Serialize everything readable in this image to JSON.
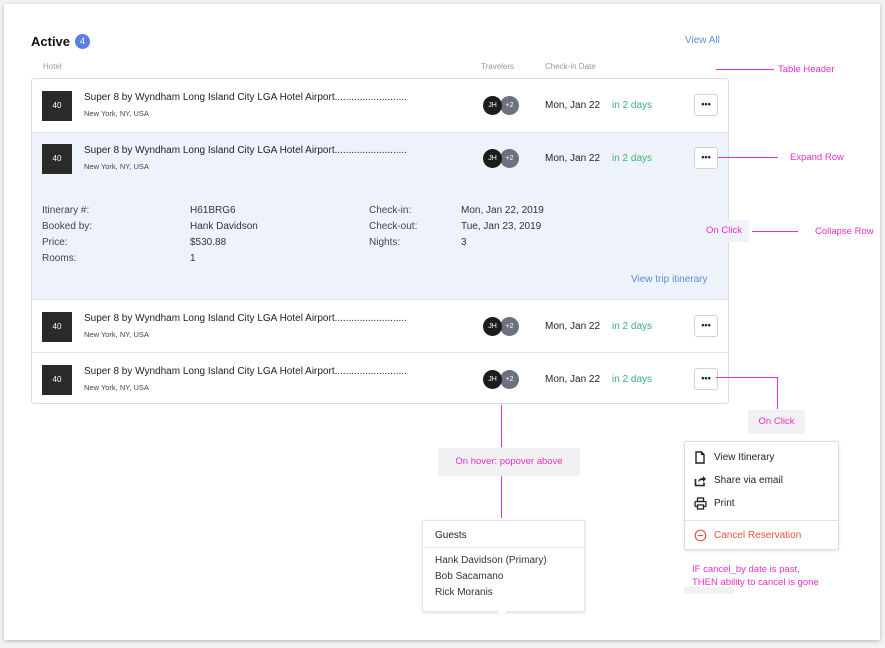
{
  "header": {
    "title": "Active",
    "count": "4",
    "view_all": "View All"
  },
  "columns": {
    "hotel": "Hotel",
    "travelers": "Travelers",
    "checkin": "Check-in Date"
  },
  "rows": [
    {
      "thumb": "40",
      "name": "Super 8 by Wyndham Long Island City LGA Hotel Airport..........................",
      "location": "New York, NY, USA",
      "avatar": "JH",
      "more": "+2",
      "date": "Mon, Jan 22",
      "relative": "in 2 days",
      "menu": "•••"
    },
    {
      "thumb": "40",
      "name": "Super 8 by Wyndham Long Island City LGA Hotel Airport..........................",
      "location": "New York, NY, USA",
      "avatar": "JH",
      "more": "+2",
      "date": "Mon, Jan 22",
      "relative": "in 2 days",
      "menu": "•••"
    },
    {
      "thumb": "40",
      "name": "Super 8 by Wyndham Long Island City LGA Hotel Airport..........................",
      "location": "New York, NY, USA",
      "avatar": "JH",
      "more": "+2",
      "date": "Mon, Jan 22",
      "relative": "in 2 days",
      "menu": "•••"
    },
    {
      "thumb": "40",
      "name": "Super 8 by Wyndham Long Island City LGA Hotel Airport..........................",
      "location": "New York, NY, USA",
      "avatar": "JH",
      "more": "+2",
      "date": "Mon, Jan 22",
      "relative": "in 2 days",
      "menu": "•••"
    }
  ],
  "detail": {
    "itinerary_label": "Itinerary #:",
    "itinerary_value": "H61BRG6",
    "booked_label": "Booked by:",
    "booked_value": "Hank Davidson",
    "price_label": "Price:",
    "price_value": "$530.88",
    "rooms_label": "Rooms:",
    "rooms_value": "1",
    "checkin_label": "Check-in:",
    "checkin_value": "Mon, Jan 22, 2019",
    "checkout_label": "Check-out:",
    "checkout_value": "Tue, Jan 23, 2019",
    "nights_label": "Nights:",
    "nights_value": "3",
    "trip_link": "View trip itinerary"
  },
  "annotations": {
    "table_header": "Table Header",
    "expand_row": "Expand Row",
    "on_click_1": "On Click",
    "collapse_row": "Collapse Row",
    "on_click_2": "On Click",
    "on_hover": "On hover: popover above",
    "cancel_note_1": "IF cancel_by date is past,",
    "cancel_note_2": "THEN ability to cancel is gone"
  },
  "popover": {
    "title": "Guests",
    "guests": [
      "Hank Davidson (Primary)",
      "Bob Sacamano",
      "Rick Moranis"
    ]
  },
  "menu": {
    "items": [
      {
        "label": "View Itinerary",
        "icon": "document-icon"
      },
      {
        "label": "Share via email",
        "icon": "share-icon"
      },
      {
        "label": "Print",
        "icon": "printer-icon"
      }
    ],
    "cancel": {
      "label": "Cancel Reservation",
      "icon": "minus-circle-icon"
    }
  },
  "colors": {
    "accent": "#5b8fd6",
    "badge": "#5b7fe0",
    "success": "#3cb371",
    "annotation": "#e62fc4",
    "danger": "#e5533d"
  }
}
